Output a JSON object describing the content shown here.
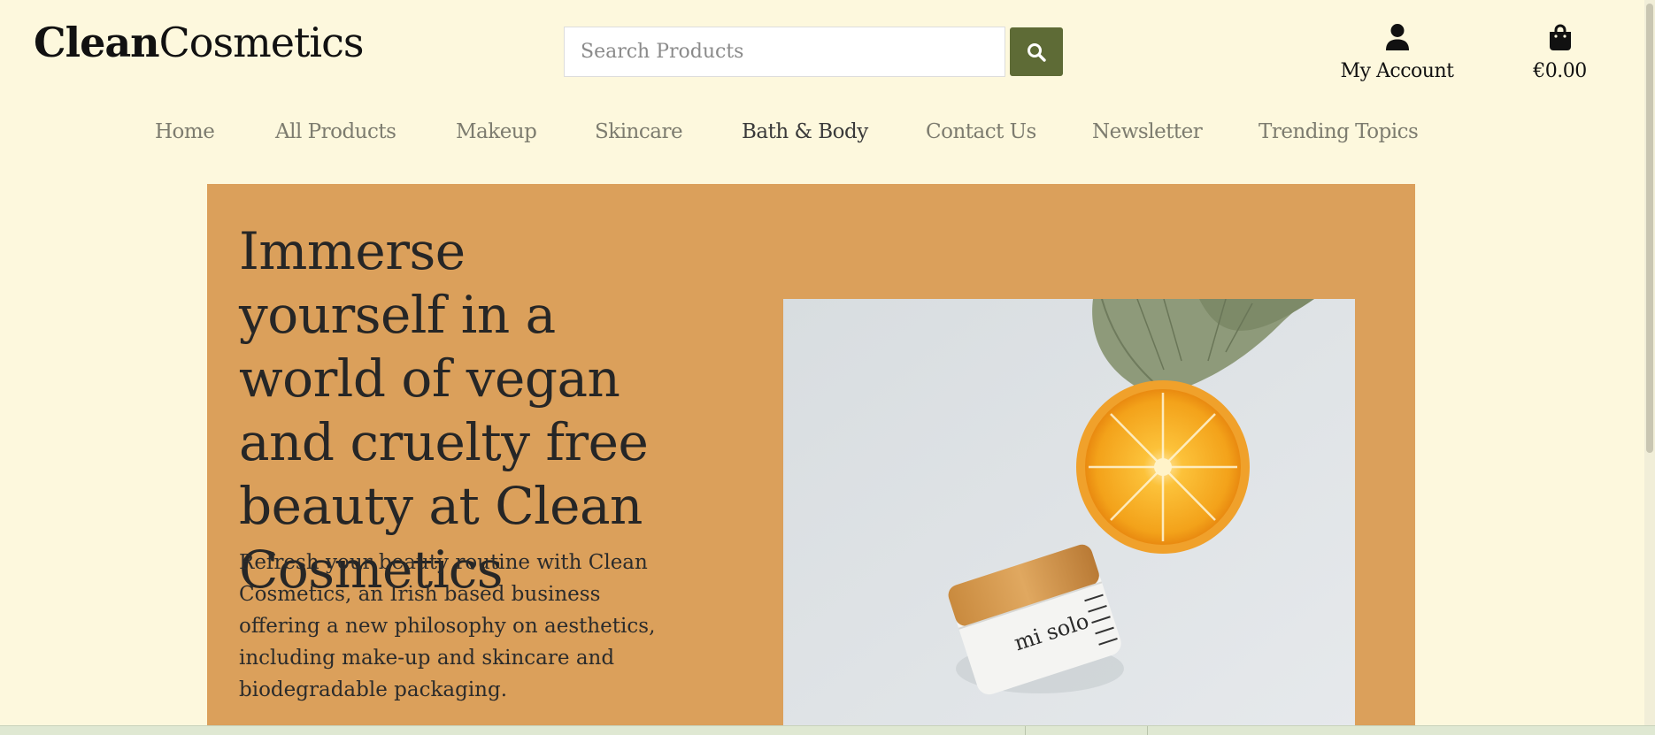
{
  "brand": {
    "logo_bold": "Clean",
    "logo_light": "Cosmetics"
  },
  "search": {
    "placeholder": "Search Products"
  },
  "header": {
    "account_label": "My Account",
    "account_icon": "user-icon",
    "bag_total": "€0.00",
    "bag_icon": "shopping-bag-icon",
    "search_icon": "magnifier-icon"
  },
  "nav": {
    "items": [
      {
        "label": "Home"
      },
      {
        "label": "All Products"
      },
      {
        "label": "Makeup"
      },
      {
        "label": "Skincare"
      },
      {
        "label": "Bath & Body"
      },
      {
        "label": "Contact Us"
      },
      {
        "label": "Newsletter"
      },
      {
        "label": "Trending Topics"
      }
    ],
    "active_label": "Bath & Body"
  },
  "hero": {
    "title": "Immerse yourself in a world of vegan and cruelty free beauty at Clean Cosmetics",
    "text": "Refresh your beauty routine with Clean Cosmetics, an Irish based business offering a new philosophy on aesthetics, including make-up and skincare and biodegradable packaging.",
    "jar_label": "mi solo"
  },
  "colors": {
    "page_bg": "#fdf8dd",
    "accent_green": "#5e6b36",
    "hero_bg": "#dba05b",
    "nav_text": "#7d7c6f"
  }
}
